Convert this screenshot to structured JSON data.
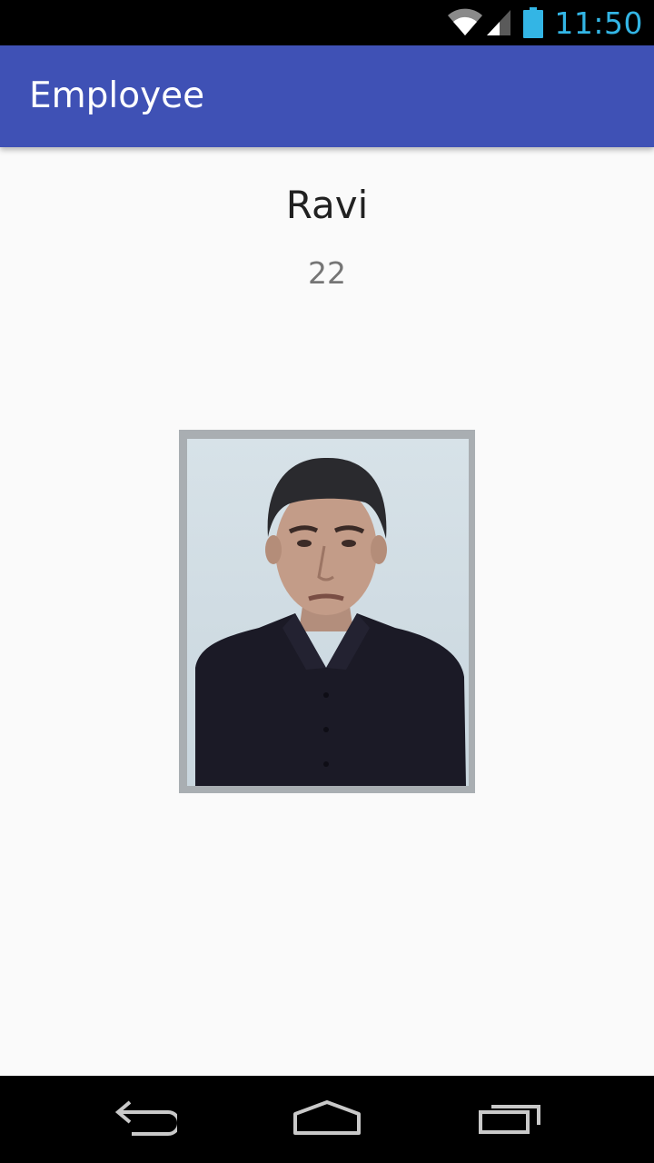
{
  "status_bar": {
    "time": "11:50",
    "icons": [
      "wifi-icon",
      "signal-icon",
      "battery-icon"
    ],
    "clock_color": "#33b5e5"
  },
  "app_bar": {
    "title": "Employee",
    "color": "#3f51b5"
  },
  "employee": {
    "name": "Ravi",
    "age": "22",
    "photo_icon": "employee-photo"
  },
  "nav_bar": {
    "buttons": [
      "back-icon",
      "home-icon",
      "recents-icon"
    ]
  }
}
